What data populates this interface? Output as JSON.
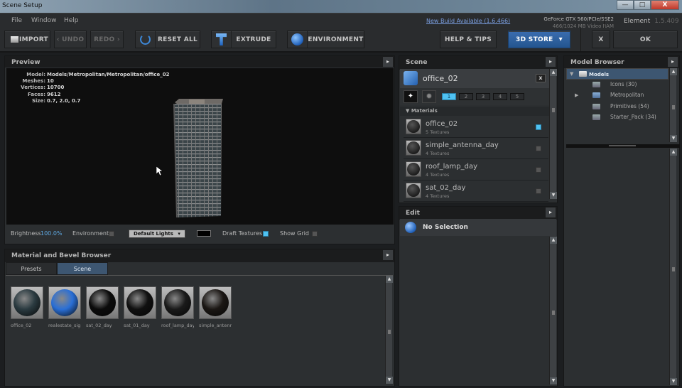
{
  "window": {
    "title": "Scene Setup",
    "min_icon": "minimize-icon",
    "max_icon": "maximize-icon",
    "close_label": "X"
  },
  "menu": {
    "items": [
      "File",
      "Window",
      "Help"
    ],
    "new_build": "New Build Available (1.6.466)",
    "gpu_name": "GeForce GTX 560/PCIe/SSE2",
    "gpu_ram": "466/1024 MB Video RAM",
    "product": "Element",
    "version": "1.5.409"
  },
  "toolbar": {
    "import": "IMPORT",
    "undo": "‹ UNDO",
    "redo": "REDO ›",
    "reset_all": "RESET ALL",
    "extrude": "EXTRUDE",
    "environment": "ENVIRONMENT",
    "help_tips": "HELP & TIPS",
    "store": "3D STORE",
    "store_arrow": "▾",
    "x": "X",
    "ok": "OK"
  },
  "preview": {
    "title": "Preview",
    "info": [
      {
        "k": "Model:",
        "v": "Models/Metropolitan/Metropolitan/office_02"
      },
      {
        "k": "Meshes:",
        "v": "10"
      },
      {
        "k": "Vertices:",
        "v": "10700"
      },
      {
        "k": "Faces:",
        "v": "9612"
      },
      {
        "k": "Size:",
        "v": "0.7, 2.0, 0.7"
      }
    ],
    "controls": {
      "brightness_label": "Brightness",
      "brightness_value": "100.0%",
      "environment_label": "Environment",
      "environment_checked": false,
      "lights_value": "Default Lights",
      "draft_label": "Draft Textures",
      "draft_checked": true,
      "grid_label": "Show Grid",
      "grid_checked": false
    }
  },
  "material_browser": {
    "title": "Material and Bevel Browser",
    "tabs": [
      {
        "label": "Presets",
        "active": false
      },
      {
        "label": "Scene",
        "active": true
      }
    ],
    "items": [
      {
        "label": "office_02",
        "color": "#2a3a40"
      },
      {
        "label": "realestate_sign",
        "color": "#2a6fd6"
      },
      {
        "label": "sat_02_day",
        "color": "#0b0b0b"
      },
      {
        "label": "sat_01_day",
        "color": "#101010"
      },
      {
        "label": "roof_lamp_day",
        "color": "#1a1a1a"
      },
      {
        "label": "simple_antenna",
        "color": "#1b1714"
      }
    ]
  },
  "scene": {
    "title": "Scene",
    "object_name": "office_02",
    "close": "x",
    "pages": [
      "1",
      "2",
      "3",
      "4",
      "5"
    ],
    "active_page": "1",
    "materials_label": "▼ Materials",
    "materials": [
      {
        "name": "office_02",
        "textures": "5 Textures",
        "checked": true
      },
      {
        "name": "simple_antenna_day",
        "textures": "4 Textures",
        "checked": false
      },
      {
        "name": "roof_lamp_day",
        "textures": "4 Textures",
        "checked": false
      },
      {
        "name": "sat_02_day",
        "textures": "4 Textures",
        "checked": false
      }
    ]
  },
  "edit": {
    "title": "Edit",
    "status": "No Selection"
  },
  "model_browser": {
    "title": "Model Browser",
    "tree": [
      {
        "label": "Models",
        "level": 0,
        "expanded": true,
        "selected": true
      },
      {
        "label": "Icons (30)",
        "level": 1
      },
      {
        "label": "Metropolitan",
        "level": 1,
        "collapsed": true
      },
      {
        "label": "Primitives (54)",
        "level": 1
      },
      {
        "label": "Starter_Pack (34)",
        "level": 1
      }
    ]
  },
  "colors": {
    "accent": "#4fc2f2",
    "store": "#2f62a3",
    "selected_tab": "#3d5671"
  }
}
